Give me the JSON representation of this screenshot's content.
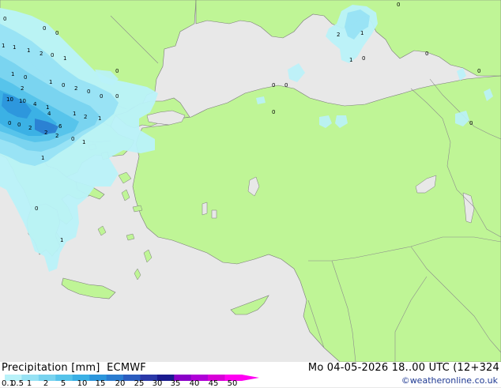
{
  "legend": {
    "title": "Precipitation [mm]",
    "model": "ECMWF",
    "datetime": "Mo 04-05-2026 18..00 UTC (12+324",
    "credit": "©weatheronline.co.uk",
    "ticks": [
      "0.1",
      "0.5",
      "1",
      "2",
      "5",
      "10",
      "15",
      "20",
      "25",
      "30",
      "35",
      "40",
      "45",
      "50"
    ],
    "colors": [
      "#b9f2f9",
      "#97e2f4",
      "#78d3ef",
      "#55c3ea",
      "#3ab0e5",
      "#2c96dc",
      "#2a7cd0",
      "#2a5cbf",
      "#2a38a8",
      "#1a1a8f",
      "#8a00c8",
      "#b000d8",
      "#d800d8",
      "#ff00f2"
    ]
  },
  "map": {
    "colors": {
      "sea": "#e8e8e8",
      "land": "#bff596",
      "border": "#8c8c8c",
      "coast": "#7a7a7a"
    },
    "point_labels": [
      "0",
      "0",
      "0",
      "1",
      "1",
      "2",
      "0",
      "1",
      "1",
      "1",
      "2",
      "0",
      "1",
      "0",
      "0",
      "2",
      "0",
      "10",
      "10",
      "4",
      "1",
      "4",
      "0",
      "2",
      "2",
      "0",
      "1",
      "2",
      "1",
      "1",
      "0",
      "2",
      "6",
      "0",
      "1",
      "1",
      "0",
      "0",
      "2",
      "1",
      "1",
      "0",
      "0",
      "0",
      "0",
      "0",
      "0",
      "0",
      "0"
    ]
  }
}
